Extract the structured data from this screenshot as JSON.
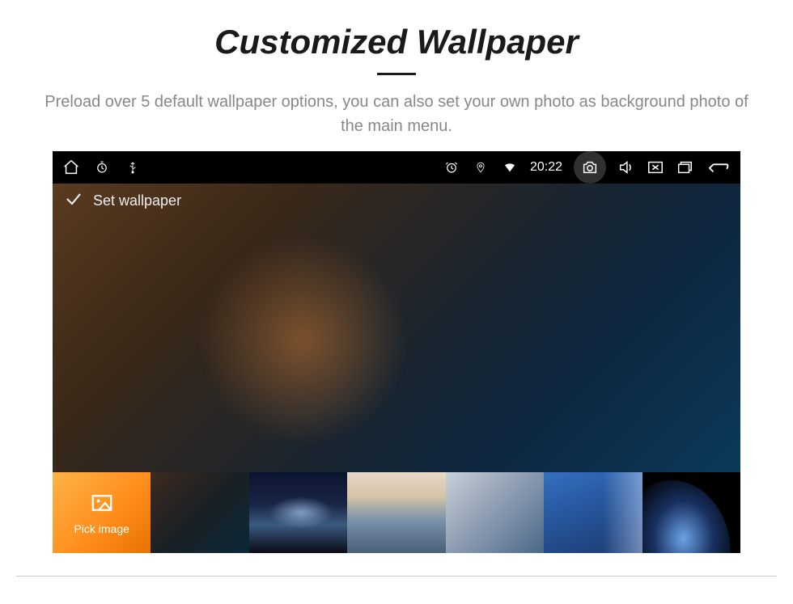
{
  "page": {
    "title": "Customized Wallpaper",
    "subtitle": "Preload over 5 default wallpaper options, you can also set your own photo as background photo of the main menu."
  },
  "statusbar": {
    "time": "20:22",
    "icons": {
      "home": "home-icon",
      "timer": "timer-icon",
      "usb": "usb-icon",
      "alarm": "alarm-icon",
      "location": "location-icon",
      "wifi": "wifi-icon",
      "camera": "camera-icon",
      "volume": "volume-icon",
      "close": "close-icon",
      "windows": "windows-icon",
      "back": "back-icon"
    }
  },
  "header": {
    "label": "Set wallpaper"
  },
  "thumbnails": {
    "pick_label": "Pick image",
    "items": [
      {
        "name": "pick-image",
        "type": "picker"
      },
      {
        "name": "wallpaper-warm-dark",
        "type": "wallpaper"
      },
      {
        "name": "wallpaper-planet-night",
        "type": "wallpaper"
      },
      {
        "name": "wallpaper-sunset-sea",
        "type": "wallpaper"
      },
      {
        "name": "wallpaper-soft-waves",
        "type": "wallpaper"
      },
      {
        "name": "wallpaper-blue-fold",
        "type": "wallpaper"
      },
      {
        "name": "wallpaper-earth-edge",
        "type": "wallpaper"
      }
    ]
  }
}
